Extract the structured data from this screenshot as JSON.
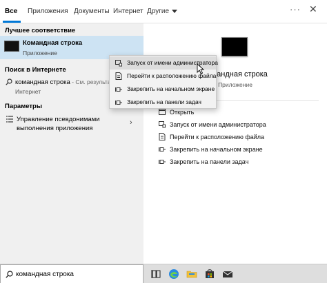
{
  "tabs": [
    {
      "label": "Все",
      "active": true
    },
    {
      "label": "Приложения"
    },
    {
      "label": "Документы"
    },
    {
      "label": "Интернет"
    },
    {
      "label": "Другие"
    }
  ],
  "toolbar": {
    "more_symbol": "···",
    "close_symbol": "✕"
  },
  "results": {
    "best_match_heading": "Лучшее соответствие",
    "best_match_title": "Командная строка",
    "best_match_subtitle": "Приложение",
    "web_heading": "Поиск в Интернете",
    "web_query": "командная строка",
    "web_hint": " - См. результаты...",
    "web_sub": "Интернет",
    "settings_heading": "Параметры",
    "settings_item": "Управление псевдонимами выполнения приложения",
    "chevron": "›"
  },
  "preview": {
    "title": "Командная строка",
    "subtitle": "Приложение",
    "actions": [
      {
        "label": "Открыть",
        "icon": "open-icon"
      },
      {
        "label": "Запуск от имени администратора",
        "icon": "admin-icon"
      },
      {
        "label": "Перейти к расположению файла",
        "icon": "file-location-icon"
      },
      {
        "label": "Закрепить на начальном экране",
        "icon": "pin-icon"
      },
      {
        "label": "Закрепить на панели задач",
        "icon": "pin-icon"
      }
    ]
  },
  "context_menu": [
    {
      "label": "Запуск от имени администратора",
      "icon": "admin-icon",
      "hover": true
    },
    {
      "label": "Перейти к расположению файла",
      "icon": "file-location-icon"
    },
    {
      "label": "Закрепить на начальном экране",
      "icon": "pin-icon"
    },
    {
      "label": "Закрепить на панели задач",
      "icon": "pin-icon"
    }
  ],
  "taskbar": {
    "search_value": "командная строка",
    "apps": [
      "task-view-icon",
      "edge-icon",
      "file-explorer-icon",
      "store-icon",
      "mail-icon"
    ]
  },
  "colors": {
    "accent": "#0078d7",
    "selection": "#cde3f3"
  }
}
